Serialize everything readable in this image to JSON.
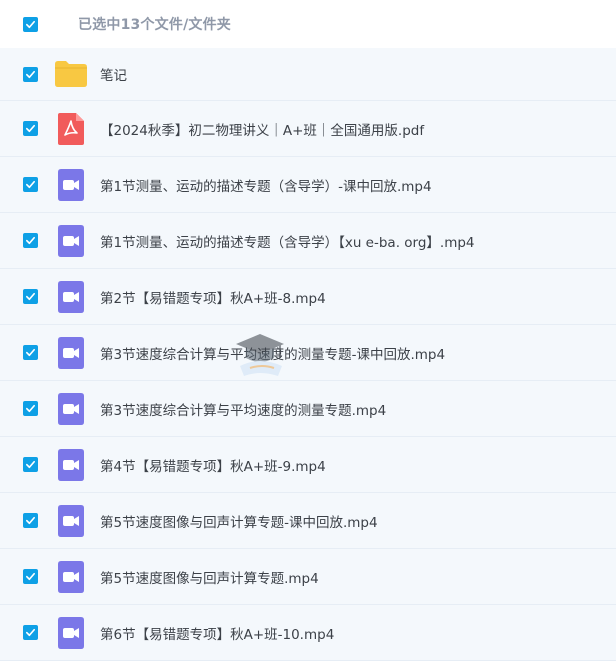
{
  "header": {
    "selection_label": "已选中13个文件/文件夹"
  },
  "files": [
    {
      "name": "笔记",
      "type": "folder",
      "icon": "folder-icon"
    },
    {
      "name": "【2024秋季】初二物理讲义｜A+班｜全国通用版.pdf",
      "type": "pdf",
      "icon": "pdf-icon"
    },
    {
      "name": "第1节测量、运动的描述专题（含导学）-课中回放.mp4",
      "type": "video",
      "icon": "video-icon"
    },
    {
      "name": "第1节测量、运动的描述专题（含导学）【xu e-ba. org】.mp4",
      "type": "video",
      "icon": "video-icon"
    },
    {
      "name": "第2节【易错题专项】秋A+班-8.mp4",
      "type": "video",
      "icon": "video-icon"
    },
    {
      "name": "第3节速度综合计算与平均速度的测量专题-课中回放.mp4",
      "type": "video",
      "icon": "video-icon"
    },
    {
      "name": "第3节速度综合计算与平均速度的测量专题.mp4",
      "type": "video",
      "icon": "video-icon"
    },
    {
      "name": "第4节【易错题专项】秋A+班-9.mp4",
      "type": "video",
      "icon": "video-icon"
    },
    {
      "name": "第5节速度图像与回声计算专题-课中回放.mp4",
      "type": "video",
      "icon": "video-icon"
    },
    {
      "name": "第5节速度图像与回声计算专题.mp4",
      "type": "video",
      "icon": "video-icon"
    },
    {
      "name": "第6节【易错题专项】秋A+班-10.mp4",
      "type": "video",
      "icon": "video-icon"
    }
  ],
  "colors": {
    "checkbox": "#0ea0e6",
    "folder": "#f8c842",
    "pdf": "#f15b5b",
    "video": "#7b77e8",
    "row_background": "#f4f8fc"
  }
}
